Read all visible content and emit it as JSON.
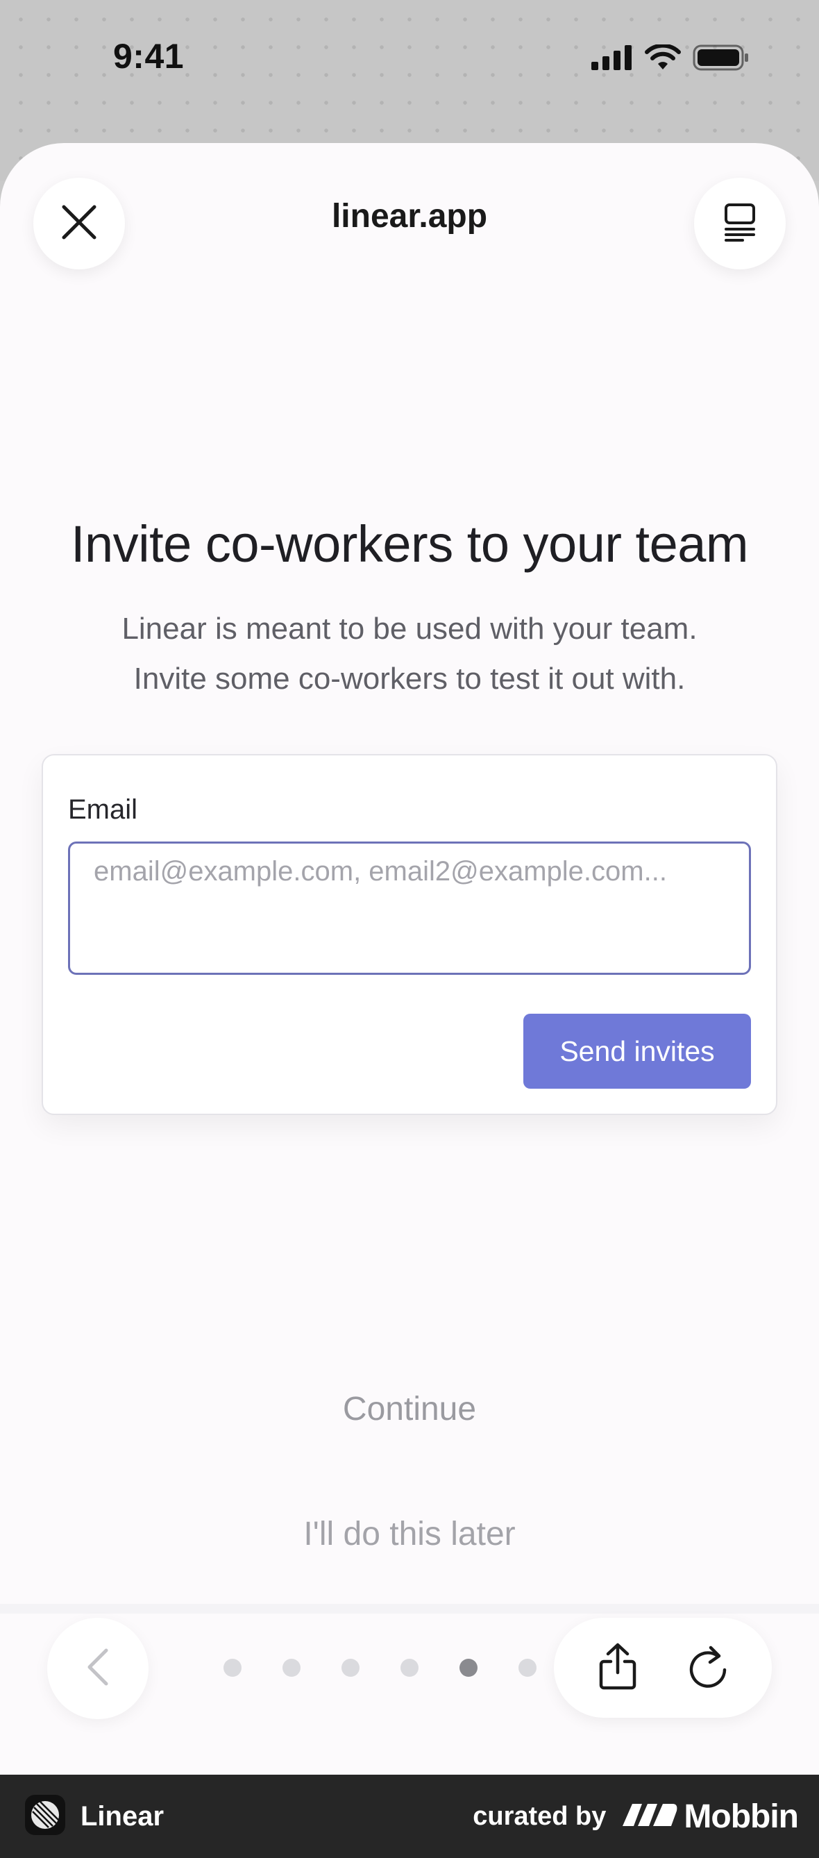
{
  "status_bar": {
    "time": "9:41",
    "icons": [
      "cellular-signal-icon",
      "wifi-icon",
      "battery-icon"
    ]
  },
  "browser": {
    "url": "linear.app",
    "icons": [
      "close-icon",
      "reader-mode-icon",
      "chevron-left-icon",
      "share-icon",
      "reload-icon"
    ]
  },
  "onboarding": {
    "title": "Invite co-workers to your team",
    "subtitle_line1": "Linear is meant to be used with your team.",
    "subtitle_line2": "Invite some co-workers to test it out with.",
    "email_label": "Email",
    "email_value": "",
    "email_placeholder": "email@example.com, email2@example.com...",
    "send_button": "Send invites",
    "continue_label": "Continue",
    "later_label": "I'll do this later",
    "progress": {
      "total_steps": 7,
      "current_step": 5
    }
  },
  "colors": {
    "accent": "#6f79d8",
    "input_border": "#6d72b8",
    "sheet_bg": "#fcfafc",
    "footer_bg": "#262626"
  },
  "footer": {
    "app_name": "Linear",
    "curated_by": "curated by",
    "brand": "Mobbin"
  }
}
